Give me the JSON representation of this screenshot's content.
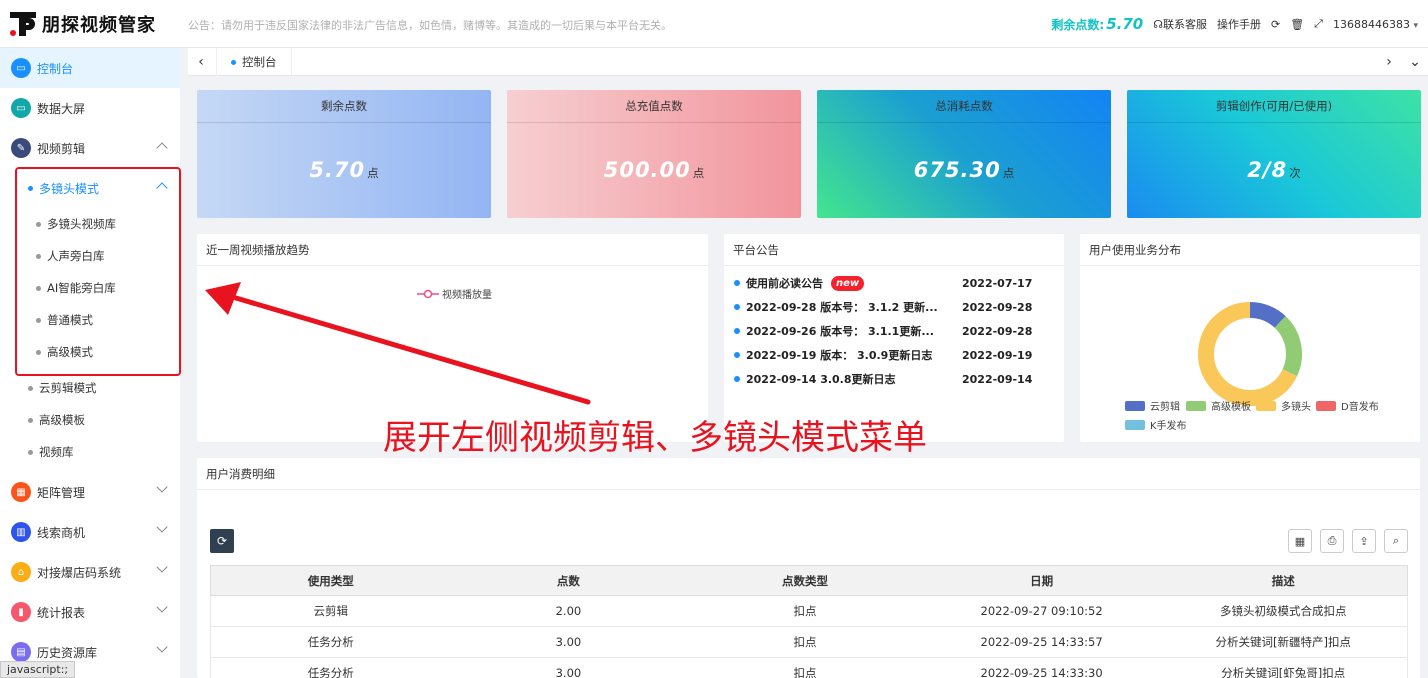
{
  "header": {
    "logo_text": "朋探视频管家",
    "notice": "公告：请勿用于违反国家法律的非法广告信息，如色情，赌博等。其造成的一切后果与本平台无关。",
    "points_label": "剩余点数:",
    "points_value": "5.70",
    "contact": "联系客服",
    "manual": "操作手册",
    "user": "13688446383"
  },
  "sidebar": {
    "dashboard": "控制台",
    "bigscreen": "数据大屏",
    "video_edit": "视频剪辑",
    "multi_lens": "多镜头模式",
    "multi_lens_items": [
      "多镜头视频库",
      "人声旁白库",
      "AI智能旁白库",
      "普通模式",
      "高级模式"
    ],
    "cloud_edit": "云剪辑模式",
    "advanced_template": "高级模板",
    "video_lib": "视频库",
    "matrix": "矩阵管理",
    "leads": "线索商机",
    "store_code": "对接爆店码系统",
    "stats": "统计报表",
    "history": "历史资源库"
  },
  "tabs": {
    "active": "控制台"
  },
  "cards": [
    {
      "title": "剩余点数",
      "value": "5.70",
      "unit": "点"
    },
    {
      "title": "总充值点数",
      "value": "500.00",
      "unit": "点"
    },
    {
      "title": "总消耗点数",
      "value": "675.30",
      "unit": "点"
    },
    {
      "title": "剪辑创作(可用/已使用)",
      "value": "2/8",
      "unit": "次"
    }
  ],
  "trend": {
    "title": "近一周视频播放趋势",
    "legend": "视频播放量"
  },
  "announcements": {
    "title": "平台公告",
    "new_badge": "new",
    "items": [
      {
        "text": "使用前必读公告",
        "date": "2022-07-17"
      },
      {
        "text": "2022-09-28 版本号： 3.1.2 更新...",
        "date": "2022-09-28"
      },
      {
        "text": "2022-09-26 版本号： 3.1.1更新...",
        "date": "2022-09-28"
      },
      {
        "text": "2022-09-19 版本： 3.0.9更新日志",
        "date": "2022-09-19"
      },
      {
        "text": "2022-09-14 3.0.8更新日志",
        "date": "2022-09-14"
      }
    ]
  },
  "distribution": {
    "title": "用户使用业务分布",
    "legend": [
      "云剪辑",
      "高级模板",
      "多镜头",
      "D音发布",
      "K手发布"
    ],
    "colors": [
      "#5470c6",
      "#91cc75",
      "#fac858",
      "#ee6666",
      "#73c0de"
    ]
  },
  "chart_data": {
    "type": "pie",
    "categories": [
      "云剪辑",
      "高级模板",
      "多镜头",
      "D音发布",
      "K手发布"
    ],
    "values": [
      12,
      20,
      68,
      0,
      0
    ]
  },
  "consumption": {
    "title": "用户消费明细",
    "columns": [
      "使用类型",
      "点数",
      "点数类型",
      "日期",
      "描述"
    ],
    "rows": [
      [
        "云剪辑",
        "2.00",
        "扣点",
        "2022-09-27 09:10:52",
        "多镜头初级模式合成扣点"
      ],
      [
        "任务分析",
        "3.00",
        "扣点",
        "2022-09-25 14:33:57",
        "分析关键词[新疆特产]扣点"
      ],
      [
        "任务分析",
        "3.00",
        "扣点",
        "2022-09-25 14:33:30",
        "分析关键词[虾兔哥]扣点"
      ]
    ]
  },
  "annotation": "展开左侧视频剪辑、多镜头模式菜单",
  "status_bar": "javascript:;"
}
